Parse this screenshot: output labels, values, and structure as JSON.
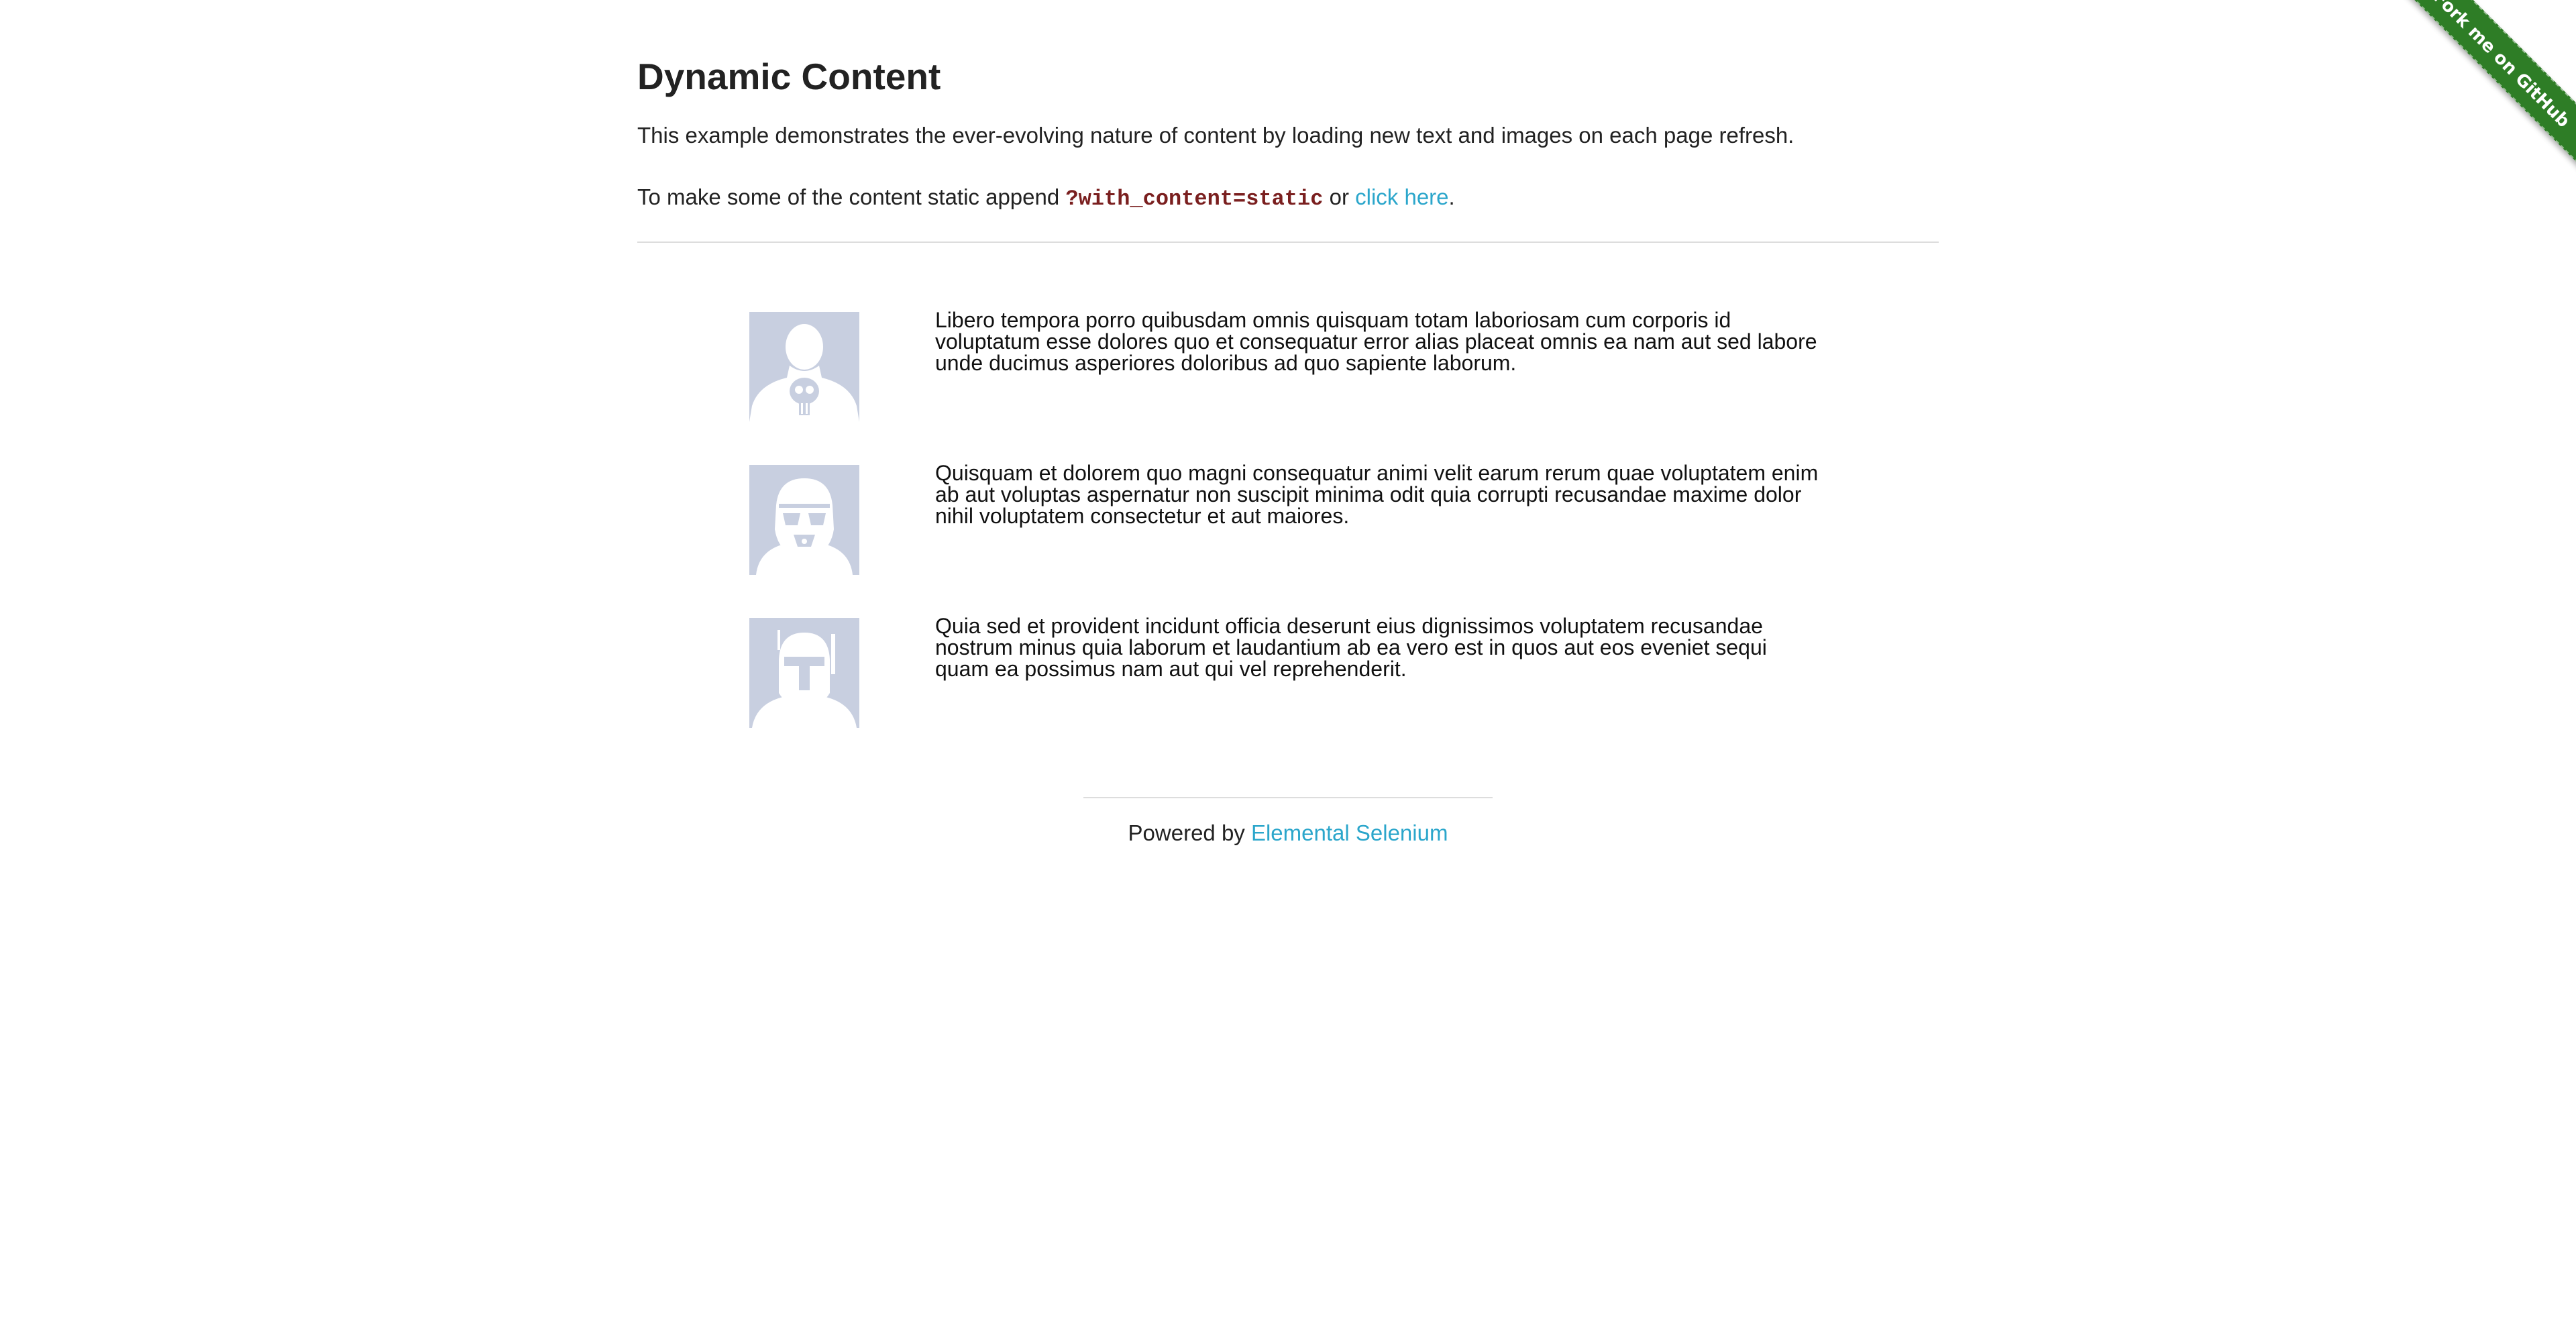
{
  "page": {
    "title": "Dynamic Content",
    "intro": "This example demonstrates the ever-evolving nature of content by loading new text and images on each page refresh.",
    "static_prefix": "To make some of the content static append ",
    "static_code": "?with_content=static",
    "static_or": " or ",
    "static_link": "click here",
    "static_suffix": "."
  },
  "rows": [
    {
      "avatar_icon": "punisher-avatar-icon",
      "text": "Libero tempora porro quibusdam omnis quisquam totam laboriosam cum corporis id voluptatum esse dolores quo et consequatur error alias placeat omnis ea nam aut sed labore unde ducimus asperiores doloribus ad quo sapiente laborum."
    },
    {
      "avatar_icon": "stormtrooper-avatar-icon",
      "text": "Quisquam et dolorem quo magni consequatur animi velit earum rerum quae voluptatem enim ab aut voluptas aspernatur non suscipit minima odit quia corrupti recusandae maxime dolor nihil voluptatem consectetur et aut maiores."
    },
    {
      "avatar_icon": "boba-fett-avatar-icon",
      "text": "Quia sed et provident incidunt officia deserunt eius dignissimos voluptatem recusandae nostrum minus quia laborum et laudantium ab ea vero est in quos aut eos eveniet sequi quam ea possimus nam aut qui vel reprehenderit."
    }
  ],
  "footer": {
    "prefix": "Powered by ",
    "link": "Elemental Selenium"
  },
  "ribbon": {
    "label": "Fork me on GitHub"
  },
  "colors": {
    "link": "#2ba6cb",
    "code": "#7a1f1f",
    "ribbon": "#2e7d26",
    "avatar_bg": "#c8cfe0"
  }
}
